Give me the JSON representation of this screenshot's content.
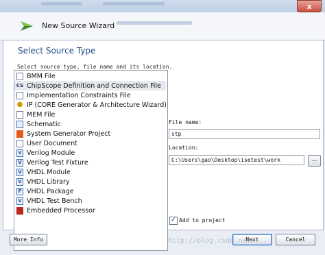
{
  "window": {
    "title": "New Source Wizard",
    "close_glyph": "x"
  },
  "page": {
    "section_title": "Select Source Type",
    "instructions": "Select source type, file name and its location."
  },
  "source_types": [
    {
      "label": "BMM File",
      "icon": "document-icon"
    },
    {
      "label": "ChipScope Definition and Connection File",
      "icon": "chipscope-icon",
      "selected": true
    },
    {
      "label": "Implementation Constraints File",
      "icon": "document-icon"
    },
    {
      "label": "IP (CORE Generator & Architecture Wizard)",
      "icon": "lightbulb-icon"
    },
    {
      "label": "MEM File",
      "icon": "document-icon"
    },
    {
      "label": "Schematic",
      "icon": "schematic-icon"
    },
    {
      "label": "System Generator Project",
      "icon": "sysgen-icon"
    },
    {
      "label": "User Document",
      "icon": "document-icon"
    },
    {
      "label": "Verilog Module",
      "icon": "verilog-icon"
    },
    {
      "label": "Verilog Test Fixture",
      "icon": "verilog-icon"
    },
    {
      "label": "VHDL Module",
      "icon": "vhdl-icon"
    },
    {
      "label": "VHDL Library",
      "icon": "vhdl-icon"
    },
    {
      "label": "VHDL Package",
      "icon": "vhdl-icon"
    },
    {
      "label": "VHDL Test Bench",
      "icon": "vhdl-icon"
    },
    {
      "label": "Embedded Processor",
      "icon": "processor-icon"
    }
  ],
  "file_name": {
    "label": "File name:",
    "value": "stp"
  },
  "location": {
    "label": "Location:",
    "value": "C:\\Users\\gao\\Desktop\\isetest\\work",
    "browse_label": "..."
  },
  "add_to_project": {
    "label": "Add to project",
    "checked": true,
    "check_glyph": "✓"
  },
  "buttons": {
    "more_info": "More Info",
    "next": "Next",
    "cancel": "Cancel"
  },
  "watermark": "http://blog.csdn.net/..."
}
